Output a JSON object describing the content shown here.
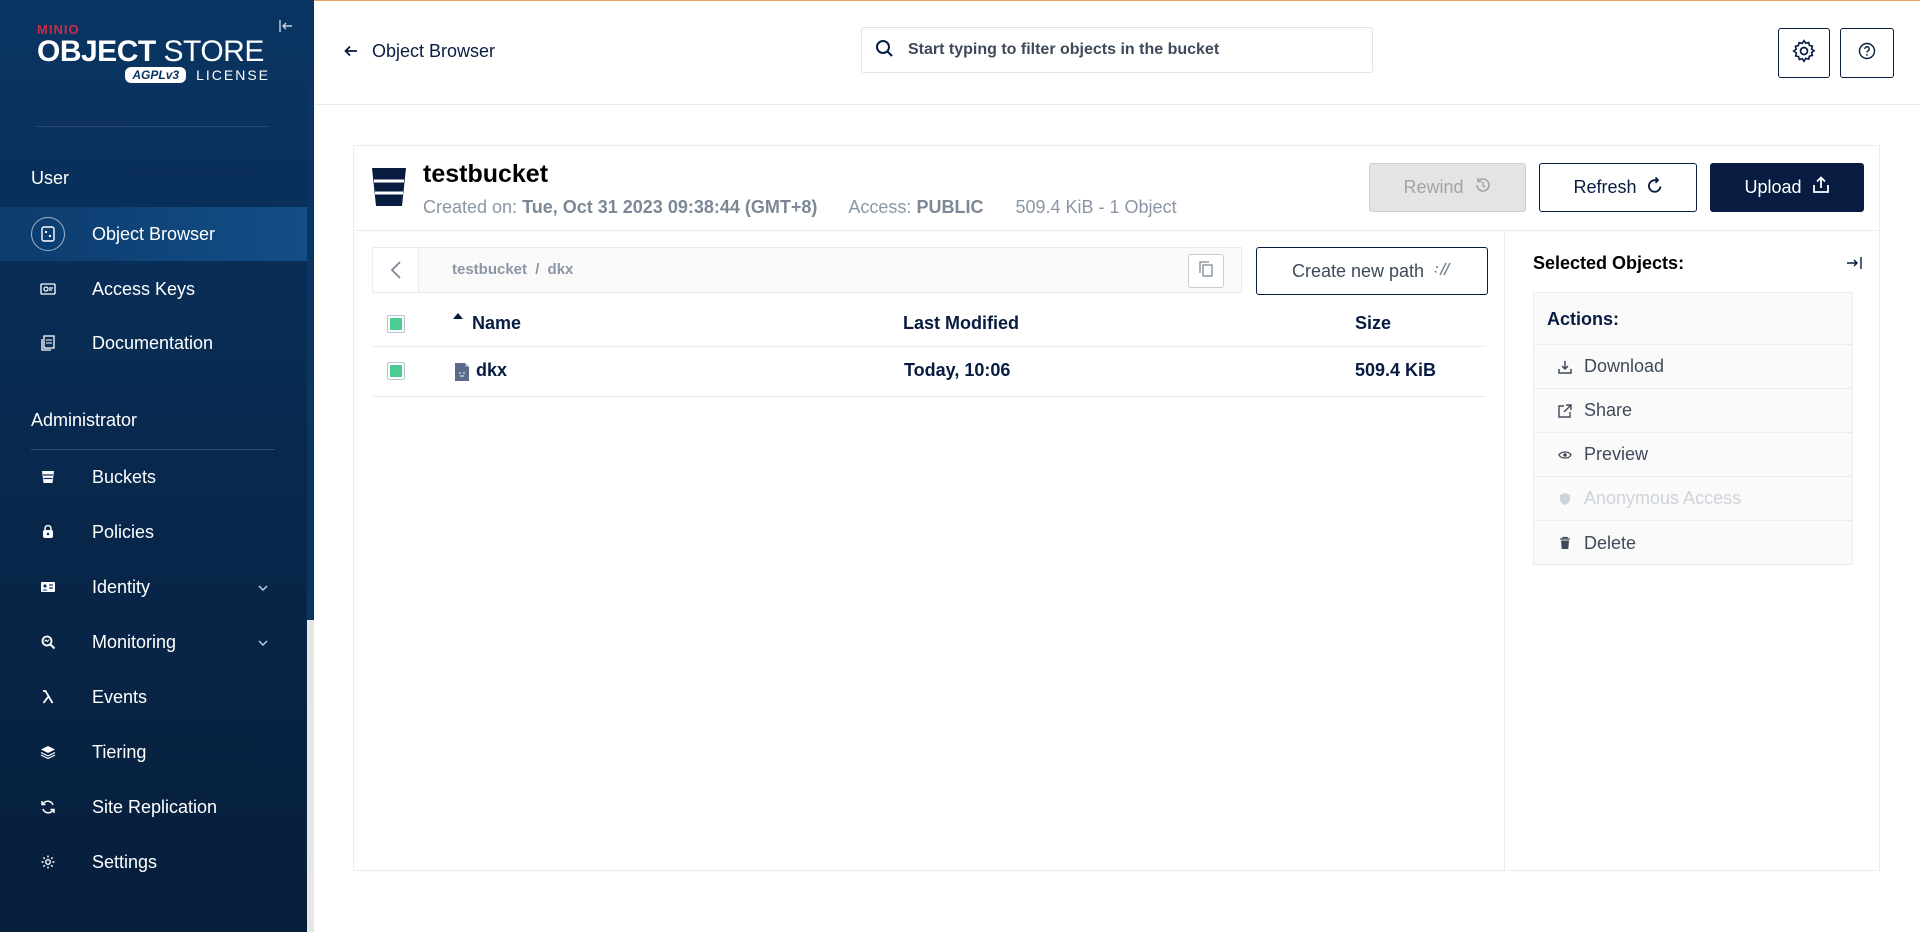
{
  "sidebar": {
    "logo": {
      "brand": "MINIO",
      "title_bold": "OBJECT",
      "title_light": "STORE",
      "badge": "AGPLv3",
      "license": "LICENSE"
    },
    "sections": {
      "user": "User",
      "admin": "Administrator"
    },
    "user_items": [
      {
        "label": "Object Browser",
        "icon": "object-browser-icon",
        "active": true
      },
      {
        "label": "Access Keys",
        "icon": "access-keys-icon"
      },
      {
        "label": "Documentation",
        "icon": "documentation-icon"
      }
    ],
    "admin_items": [
      {
        "label": "Buckets",
        "icon": "bucket-icon"
      },
      {
        "label": "Policies",
        "icon": "policies-icon"
      },
      {
        "label": "Identity",
        "icon": "identity-icon",
        "expandable": true
      },
      {
        "label": "Monitoring",
        "icon": "monitoring-icon",
        "expandable": true
      },
      {
        "label": "Events",
        "icon": "lambda-icon"
      },
      {
        "label": "Tiering",
        "icon": "tiering-icon"
      },
      {
        "label": "Site Replication",
        "icon": "replication-icon"
      },
      {
        "label": "Settings",
        "icon": "settings-icon"
      }
    ]
  },
  "header": {
    "back_label": "Object Browser",
    "search_placeholder": "Start typing to filter objects in the bucket"
  },
  "bucket": {
    "name": "testbucket",
    "created_label": "Created on:",
    "created_value": "Tue, Oct 31 2023 09:38:44 (GMT+8)",
    "access_label": "Access:",
    "access_value": "PUBLIC",
    "summary": "509.4 KiB - 1 Object",
    "buttons": {
      "rewind": "Rewind",
      "refresh": "Refresh",
      "upload": "Upload"
    }
  },
  "path": {
    "bucket": "testbucket",
    "separator": "/",
    "folder": "dkx",
    "new_path_label": "Create new path"
  },
  "table": {
    "columns": {
      "name": "Name",
      "modified": "Last Modified",
      "size": "Size"
    },
    "rows": [
      {
        "name": "dkx",
        "modified": "Today, 10:06",
        "size": "509.4 KiB"
      }
    ]
  },
  "selection": {
    "title": "Selected Objects:",
    "actions_title": "Actions:",
    "actions": [
      {
        "label": "Download",
        "icon": "download-icon"
      },
      {
        "label": "Share",
        "icon": "share-icon"
      },
      {
        "label": "Preview",
        "icon": "eye-icon"
      },
      {
        "label": "Anonymous Access",
        "icon": "shield-icon",
        "disabled": true
      },
      {
        "label": "Delete",
        "icon": "trash-icon"
      }
    ]
  },
  "colors": {
    "sidebar_bg": "#0a3563",
    "primary": "#081c42",
    "checkbox_green": "#4ccb92",
    "brand_red": "#c72c48"
  }
}
